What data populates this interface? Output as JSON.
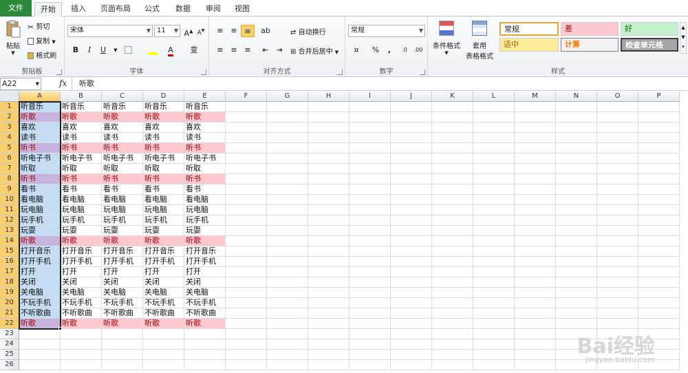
{
  "tabs": [
    {
      "label": "文件",
      "id": "file"
    },
    {
      "label": "开始",
      "id": "home"
    },
    {
      "label": "插入",
      "id": "insert"
    },
    {
      "label": "页面布局",
      "id": "layout"
    },
    {
      "label": "公式",
      "id": "formulas"
    },
    {
      "label": "数据",
      "id": "data"
    },
    {
      "label": "审阅",
      "id": "review"
    },
    {
      "label": "视图",
      "id": "view"
    }
  ],
  "ribbon": {
    "clipboard": {
      "label": "剪贴板",
      "paste": "粘贴",
      "cut": "剪切",
      "copy": "复制",
      "format_painter": "格式刷"
    },
    "font": {
      "label": "字体",
      "name": "宋体",
      "size": "11",
      "bold": "B",
      "italic": "I",
      "underline": "U",
      "font_color_glyph": "A",
      "phonetic": "变"
    },
    "alignment": {
      "label": "对齐方式",
      "wrap": "自动换行",
      "merge": "合并后居中"
    },
    "number": {
      "label": "数字",
      "format": "常规",
      "percent": "%",
      "comma": ","
    },
    "styles": {
      "label": "样式",
      "conditional": "条件格式",
      "table_line1": "套用",
      "table_line2": "表格格式",
      "normal": "常规",
      "bad": "差",
      "good": "好",
      "neutral": "适中",
      "calc": "计算",
      "check": "检查单元格"
    }
  },
  "formula_bar": {
    "name_box": "A22",
    "fx": "fx",
    "content": "听歌"
  },
  "columns": [
    "A",
    "B",
    "C",
    "D",
    "E",
    "F",
    "G",
    "H",
    "I",
    "J",
    "K",
    "L",
    "M",
    "N",
    "O",
    "P"
  ],
  "rows": [
    {
      "n": "1",
      "text": "听音乐",
      "pink": false
    },
    {
      "n": "2",
      "text": "听歌",
      "pink": true
    },
    {
      "n": "3",
      "text": "喜欢",
      "pink": false
    },
    {
      "n": "4",
      "text": "读书",
      "pink": false
    },
    {
      "n": "5",
      "text": "听书",
      "pink": true
    },
    {
      "n": "6",
      "text": "听电子书",
      "pink": false
    },
    {
      "n": "7",
      "text": "听取",
      "pink": false
    },
    {
      "n": "8",
      "text": "听书",
      "pink": true
    },
    {
      "n": "9",
      "text": "看书",
      "pink": false
    },
    {
      "n": "10",
      "text": "看电脑",
      "pink": false
    },
    {
      "n": "11",
      "text": "玩电脑",
      "pink": false
    },
    {
      "n": "12",
      "text": "玩手机",
      "pink": false
    },
    {
      "n": "13",
      "text": "玩耍",
      "pink": false
    },
    {
      "n": "14",
      "text": "听歌",
      "pink": true
    },
    {
      "n": "15",
      "text": "打开音乐",
      "pink": false
    },
    {
      "n": "16",
      "text": "打开手机",
      "pink": false
    },
    {
      "n": "17",
      "text": "打开",
      "pink": false
    },
    {
      "n": "18",
      "text": "关闭",
      "pink": false
    },
    {
      "n": "19",
      "text": "关电脑",
      "pink": false
    },
    {
      "n": "20",
      "text": "不玩手机",
      "pink": false
    },
    {
      "n": "21",
      "text": "不听歌曲",
      "pink": false
    },
    {
      "n": "22",
      "text": "听歌",
      "pink": true
    },
    {
      "n": "23",
      "text": "",
      "pink": false
    },
    {
      "n": "24",
      "text": "",
      "pink": false
    },
    {
      "n": "25",
      "text": "",
      "pink": false
    },
    {
      "n": "26",
      "text": "",
      "pink": false
    }
  ],
  "filled_columns": 5,
  "selected_column": "A",
  "colors": {
    "pink_fill": "#ffc7ce",
    "pink_text": "#9c0006",
    "selection_blue": "#c5dcf5",
    "file_tab": "#2a8a3a"
  },
  "watermark": {
    "main": "Bai经验",
    "sub": "jingyan.baidu.com"
  }
}
